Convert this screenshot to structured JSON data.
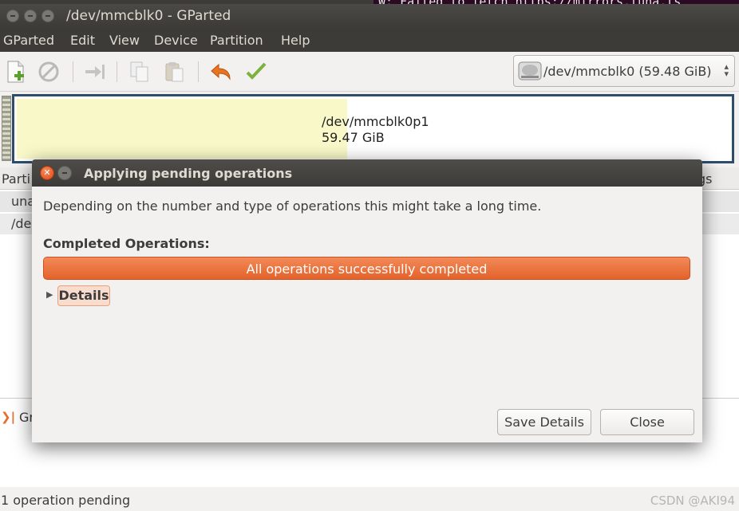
{
  "terminal": {
    "text": "W: Failed to fetch https://mirrors.tuna.ts"
  },
  "window": {
    "title": "/dev/mmcblk0 - GParted"
  },
  "menubar": {
    "items": [
      "GParted",
      "Edit",
      "View",
      "Device",
      "Partition",
      "Help"
    ]
  },
  "toolbar": {
    "icons": [
      "new-icon",
      "delete-icon",
      "resize-move-icon",
      "copy-icon",
      "paste-icon",
      "undo-icon",
      "apply-icon"
    ]
  },
  "device_selector": {
    "label": "/dev/mmcblk0  (59.48 GiB)"
  },
  "visualizer": {
    "partition_name": "/dev/mmcblk0p1",
    "partition_size": "59.47 GiB",
    "used_fraction": 0.46,
    "colors": {
      "used": "#f8f8c8",
      "border": "#2d4d6b"
    }
  },
  "partition_list": {
    "header_left": "Parti",
    "header_right": "gs",
    "rows": [
      "una",
      "/de"
    ]
  },
  "operations_log": {
    "icon": "operation-icon",
    "text": "Gr"
  },
  "statusbar": {
    "text": "1 operation pending",
    "watermark": "CSDN @AKI94"
  },
  "dialog": {
    "title": "Applying pending operations",
    "message": "Depending on the number and type of operations this might take a long time.",
    "completed_label": "Completed Operations:",
    "progress": {
      "text": "All operations successfully completed",
      "fraction": 1.0,
      "color": "#e4622a"
    },
    "details_label": "Details",
    "buttons": {
      "save_details": "Save Details",
      "close": "Close"
    }
  }
}
